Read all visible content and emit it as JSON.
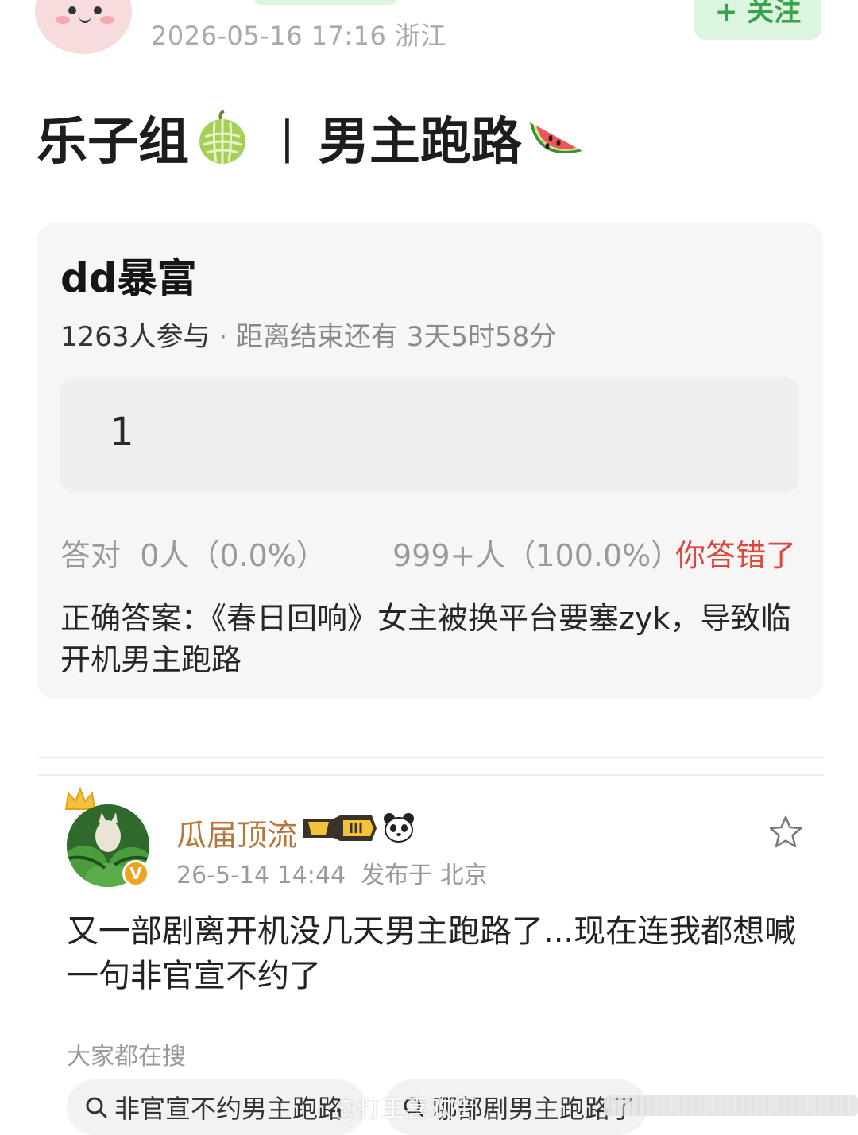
{
  "post": {
    "meta": "2026-05-16 17:16  浙江",
    "follow_label": "+ 关注",
    "headline_left": "乐子组",
    "headline_sep": "|",
    "headline_right": "男主跑路"
  },
  "quiz": {
    "title": "dd暴富",
    "participants": "1263人参与",
    "dot": " · ",
    "countdown_label": "距离结束还有 ",
    "countdown": "3天5时58分",
    "option": "1",
    "correct_label": "答对",
    "correct_value": "0人（0.0%）",
    "other_value": "999+人（100.0%）",
    "result": "你答错了",
    "answer": "正确答案：《春日回响》女主被换平台要塞zyk，导致临开机男主跑路"
  },
  "comment": {
    "author": "瓜届顶流",
    "time": "26-5-14 14:44",
    "location": "发布于 北京",
    "text": "又一部剧离开机没几天男主跑路了...现在连我都想喊一句非官宣不约了",
    "verified_mark": "V"
  },
  "search": {
    "heading": "大家都在搜",
    "chips": [
      "非官宣不约男主跑路",
      "哪部剧男主跑路了"
    ]
  },
  "watermark": "@打王喜欢街",
  "icons": {
    "melon": "melon-emoji-icon",
    "watermelon": "watermelon-emoji-icon",
    "star": "star-outline-icon",
    "search": "magnifier-icon",
    "crown": "crown-icon",
    "panda": "panda-icon"
  },
  "colors": {
    "accent_green": "#3aa24a",
    "error_red": "#e0453c",
    "author_gold": "#b8773a"
  }
}
